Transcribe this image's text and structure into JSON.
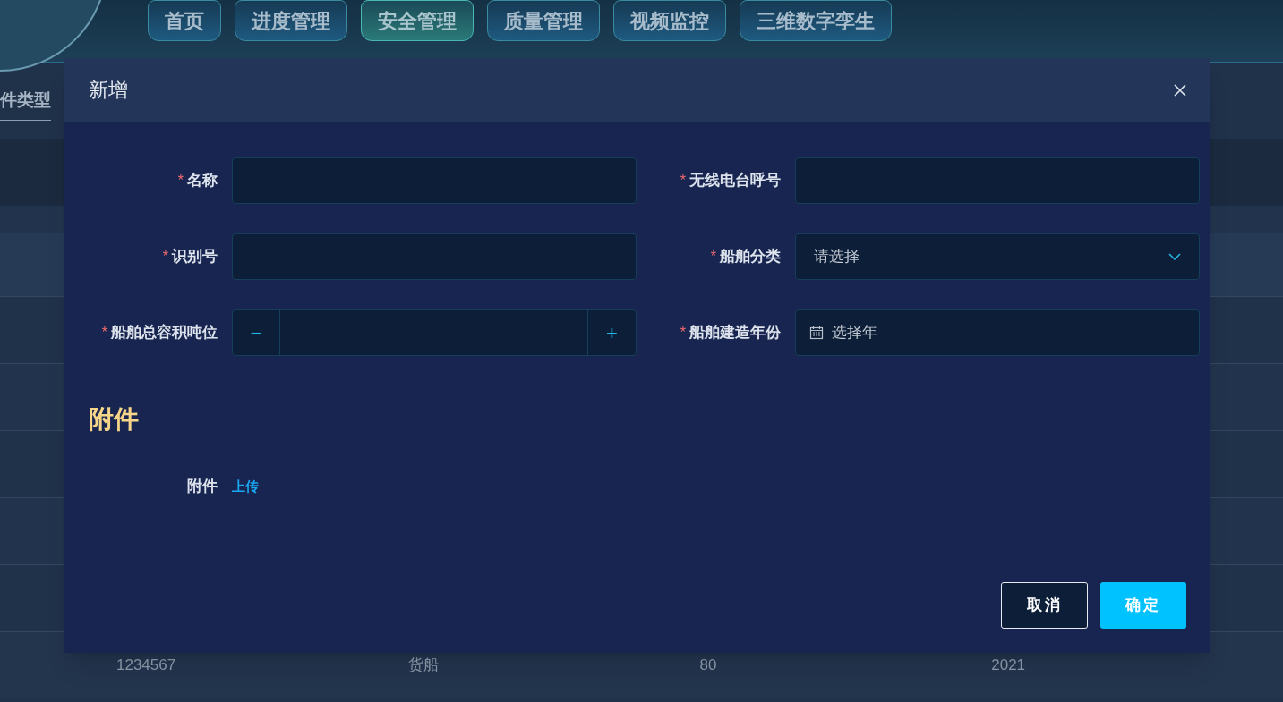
{
  "nav": {
    "tabs": [
      {
        "label": "首页",
        "selected": false
      },
      {
        "label": "进度管理",
        "selected": false
      },
      {
        "label": "安全管理",
        "selected": true
      },
      {
        "label": "质量管理",
        "selected": false
      },
      {
        "label": "视频监控",
        "selected": false
      },
      {
        "label": "三维数字孪生",
        "selected": false
      }
    ]
  },
  "side_tab": {
    "label": "件类型"
  },
  "table": {
    "last_row": [
      "1234567",
      "货船",
      "80",
      "2021"
    ]
  },
  "dialog": {
    "title": "新增",
    "required_mark": "*",
    "fields": [
      {
        "kind": "text",
        "label": "名称",
        "required": true
      },
      {
        "kind": "text",
        "label": "无线电台呼号",
        "required": true
      },
      {
        "kind": "text",
        "label": "识别号",
        "required": true
      },
      {
        "kind": "select",
        "label": "船舶分类",
        "required": true,
        "placeholder": "请选择"
      },
      {
        "kind": "number",
        "label": "船舶总容积吨位",
        "required": true,
        "minus": "−",
        "plus": "+"
      },
      {
        "kind": "year",
        "label": "船舶建造年份",
        "required": true,
        "placeholder": "选择年"
      }
    ],
    "attachments": {
      "title": "附件",
      "label": "附件",
      "link": "上传"
    },
    "buttons": [
      {
        "kind": "secondary",
        "label": "取消"
      },
      {
        "kind": "primary",
        "label": "确定"
      }
    ]
  }
}
